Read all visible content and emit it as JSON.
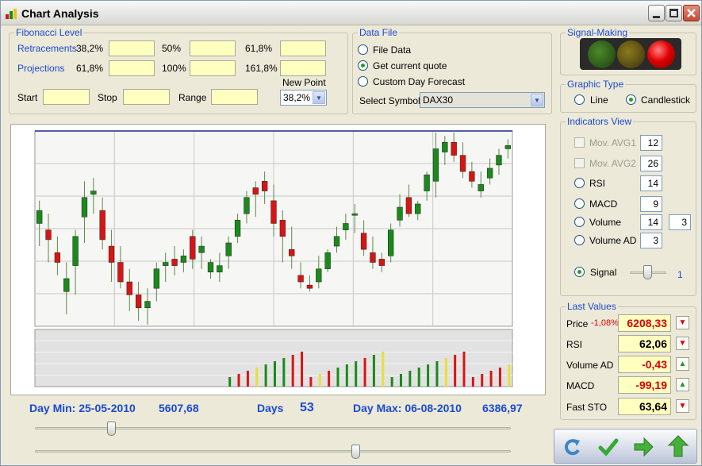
{
  "window": {
    "title": "Chart Analysis"
  },
  "fibonacci": {
    "legend": "Fibonacci Level",
    "retracements_label": "Retracements",
    "projections_label": "Projections",
    "ret_levels": [
      "38,2%",
      "50%",
      "61,8%"
    ],
    "proj_levels": [
      "61,8%",
      "100%",
      "161,8%"
    ],
    "start_label": "Start",
    "stop_label": "Stop",
    "range_label": "Range",
    "new_point_label": "New Point",
    "new_point_value": "38,2%"
  },
  "data_file": {
    "legend": "Data File",
    "options": [
      "File Data",
      "Get current quote",
      "Custom Day Forecast"
    ],
    "selected": 1,
    "select_symbol_label": "Select Symbol",
    "symbol": "DAX30"
  },
  "signal_making": {
    "legend": "Signal-Making",
    "lights": [
      "green",
      "yellow",
      "red"
    ],
    "active": "red"
  },
  "graphic_type": {
    "legend": "Graphic Type",
    "options": [
      "Line",
      "Candlestick"
    ],
    "selected": "Candlestick"
  },
  "indicators": {
    "legend": "Indicators View",
    "mov_avg1": {
      "label": "Mov. AVG1",
      "value": "12"
    },
    "mov_avg2": {
      "label": "Mov. AVG2",
      "value": "26"
    },
    "rsi": {
      "label": "RSI",
      "value": "14"
    },
    "macd": {
      "label": "MACD",
      "value": "9"
    },
    "volume": {
      "label": "Volume",
      "value": "14",
      "value2": "3"
    },
    "volume_ad": {
      "label": "Volume AD",
      "value": "3"
    },
    "signal": {
      "label": "Signal",
      "value": "1"
    }
  },
  "last_values": {
    "legend": "Last Values",
    "price": {
      "label": "Price",
      "change": "-1,08%",
      "value": "6208,33"
    },
    "rsi": {
      "label": "RSI",
      "value": "62,06"
    },
    "volume_ad": {
      "label": "Volume AD",
      "value": "-0,43"
    },
    "macd": {
      "label": "MACD",
      "value": "-99,19"
    },
    "fast_sto": {
      "label": "Fast STO",
      "value": "63,64"
    }
  },
  "stats": {
    "day_min": "Day Min: 25-05-2010",
    "min_value": "5607,68",
    "days_label": "Days",
    "days": "53",
    "day_max": "Day Max: 06-08-2010",
    "max_value": "6386,97"
  },
  "colors": {
    "up": "#1a8a1a",
    "down": "#d81414",
    "neutral": "#e6e03a",
    "accent": "#1a4ad0"
  },
  "chart_data": {
    "type": "candlestick",
    "title": "",
    "series": [
      {
        "o": 5920,
        "h": 5990,
        "l": 5850,
        "c": 5960
      },
      {
        "o": 5900,
        "h": 5950,
        "l": 5800,
        "c": 5870
      },
      {
        "o": 5830,
        "h": 5880,
        "l": 5760,
        "c": 5800
      },
      {
        "o": 5710,
        "h": 5800,
        "l": 5640,
        "c": 5750
      },
      {
        "o": 5790,
        "h": 5900,
        "l": 5700,
        "c": 5880
      },
      {
        "o": 5940,
        "h": 6050,
        "l": 5860,
        "c": 6000
      },
      {
        "o": 6010,
        "h": 6060,
        "l": 5950,
        "c": 6020
      },
      {
        "o": 5960,
        "h": 6000,
        "l": 5840,
        "c": 5870
      },
      {
        "o": 5850,
        "h": 5900,
        "l": 5740,
        "c": 5800
      },
      {
        "o": 5800,
        "h": 5850,
        "l": 5720,
        "c": 5740
      },
      {
        "o": 5740,
        "h": 5780,
        "l": 5650,
        "c": 5700
      },
      {
        "o": 5700,
        "h": 5740,
        "l": 5620,
        "c": 5660
      },
      {
        "o": 5660,
        "h": 5720,
        "l": 5608,
        "c": 5680
      },
      {
        "o": 5720,
        "h": 5800,
        "l": 5680,
        "c": 5780
      },
      {
        "o": 5790,
        "h": 5830,
        "l": 5740,
        "c": 5800
      },
      {
        "o": 5810,
        "h": 5850,
        "l": 5760,
        "c": 5790
      },
      {
        "o": 5800,
        "h": 5840,
        "l": 5770,
        "c": 5820
      },
      {
        "o": 5880,
        "h": 5900,
        "l": 5780,
        "c": 5810
      },
      {
        "o": 5830,
        "h": 5880,
        "l": 5780,
        "c": 5850
      },
      {
        "o": 5770,
        "h": 5810,
        "l": 5750,
        "c": 5800
      },
      {
        "o": 5770,
        "h": 5830,
        "l": 5740,
        "c": 5790
      },
      {
        "o": 5820,
        "h": 5880,
        "l": 5780,
        "c": 5860
      },
      {
        "o": 5880,
        "h": 5950,
        "l": 5860,
        "c": 5930
      },
      {
        "o": 5950,
        "h": 6020,
        "l": 5920,
        "c": 6000
      },
      {
        "o": 6030,
        "h": 6050,
        "l": 5940,
        "c": 6010
      },
      {
        "o": 6050,
        "h": 6080,
        "l": 5980,
        "c": 6020
      },
      {
        "o": 5990,
        "h": 6040,
        "l": 5880,
        "c": 5920
      },
      {
        "o": 5930,
        "h": 5960,
        "l": 5800,
        "c": 5880
      },
      {
        "o": 5840,
        "h": 5910,
        "l": 5780,
        "c": 5820
      },
      {
        "o": 5760,
        "h": 5800,
        "l": 5720,
        "c": 5740
      },
      {
        "o": 5730,
        "h": 5760,
        "l": 5710,
        "c": 5720
      },
      {
        "o": 5740,
        "h": 5820,
        "l": 5720,
        "c": 5780
      },
      {
        "o": 5780,
        "h": 5840,
        "l": 5770,
        "c": 5830
      },
      {
        "o": 5850,
        "h": 5910,
        "l": 5830,
        "c": 5880
      },
      {
        "o": 5900,
        "h": 5950,
        "l": 5870,
        "c": 5920
      },
      {
        "o": 5950,
        "h": 5980,
        "l": 5890,
        "c": 5950
      },
      {
        "o": 5890,
        "h": 5930,
        "l": 5820,
        "c": 5840
      },
      {
        "o": 5830,
        "h": 5880,
        "l": 5780,
        "c": 5800
      },
      {
        "o": 5810,
        "h": 5830,
        "l": 5770,
        "c": 5790
      },
      {
        "o": 5820,
        "h": 5920,
        "l": 5800,
        "c": 5900
      },
      {
        "o": 5930,
        "h": 6010,
        "l": 5910,
        "c": 5970
      },
      {
        "o": 6000,
        "h": 6040,
        "l": 5940,
        "c": 5950
      },
      {
        "o": 5950,
        "h": 5990,
        "l": 5930,
        "c": 5980
      },
      {
        "o": 6020,
        "h": 6080,
        "l": 5990,
        "c": 6070
      },
      {
        "o": 6050,
        "h": 6200,
        "l": 6000,
        "c": 6150
      },
      {
        "o": 6140,
        "h": 6190,
        "l": 6100,
        "c": 6170
      },
      {
        "o": 6170,
        "h": 6200,
        "l": 6110,
        "c": 6130
      },
      {
        "o": 6130,
        "h": 6170,
        "l": 6060,
        "c": 6080
      },
      {
        "o": 6080,
        "h": 6110,
        "l": 6030,
        "c": 6050
      },
      {
        "o": 6020,
        "h": 6080,
        "l": 6000,
        "c": 6040
      },
      {
        "o": 6060,
        "h": 6120,
        "l": 6040,
        "c": 6090
      },
      {
        "o": 6100,
        "h": 6150,
        "l": 6070,
        "c": 6130
      },
      {
        "o": 6150,
        "h": 6180,
        "l": 6120,
        "c": 6160
      }
    ]
  }
}
